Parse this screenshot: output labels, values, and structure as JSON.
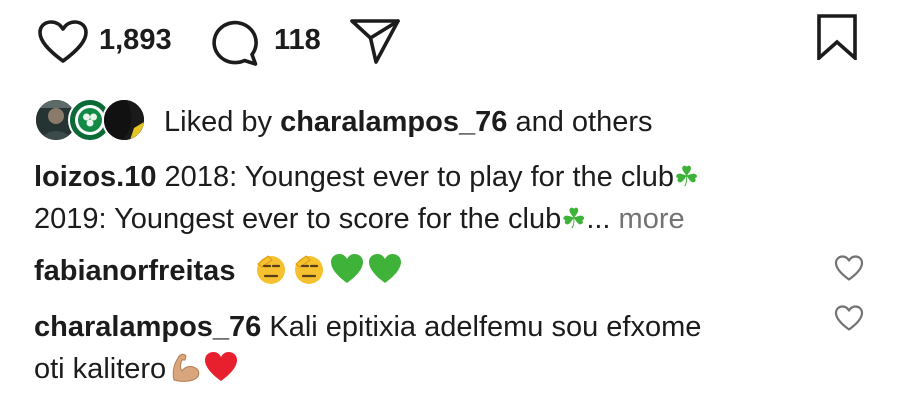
{
  "actions": {
    "like_count": "1,893",
    "comment_count": "118",
    "icons": [
      "heart-icon",
      "comment-icon",
      "send-icon",
      "bookmark-icon"
    ]
  },
  "likes": {
    "prefix": "Liked by ",
    "user": "charalampos_76",
    "suffix": " and others"
  },
  "caption": {
    "user": "loizos.10",
    "line1": " 2018: Youngest ever to play for the club",
    "line1_emoji": "☘",
    "line2": "2019: Youngest ever to score for the club",
    "line2_emoji": "☘",
    "ellipsis": "...",
    "more": " more"
  },
  "comments": [
    {
      "user": "fabianorfreitas",
      "emojis": [
        {
          "name": "saluting-face",
          "color": "#f5c12e"
        },
        {
          "name": "saluting-face",
          "color": "#f5c12e"
        },
        {
          "name": "green-heart",
          "color": "#3fb23a"
        },
        {
          "name": "green-heart",
          "color": "#3fb23a"
        }
      ]
    },
    {
      "user": "charalampos_76",
      "text": " Kali epitixia adelfemu sou efxome",
      "text2": "oti kalitero",
      "emojis": [
        {
          "name": "flexed-biceps",
          "color": "#d9a57c"
        },
        {
          "name": "red-heart",
          "color": "#e8202e"
        }
      ]
    }
  ],
  "colors": {
    "text": "#1c1c1c",
    "muted": "#737373",
    "background": "#ffffff"
  }
}
